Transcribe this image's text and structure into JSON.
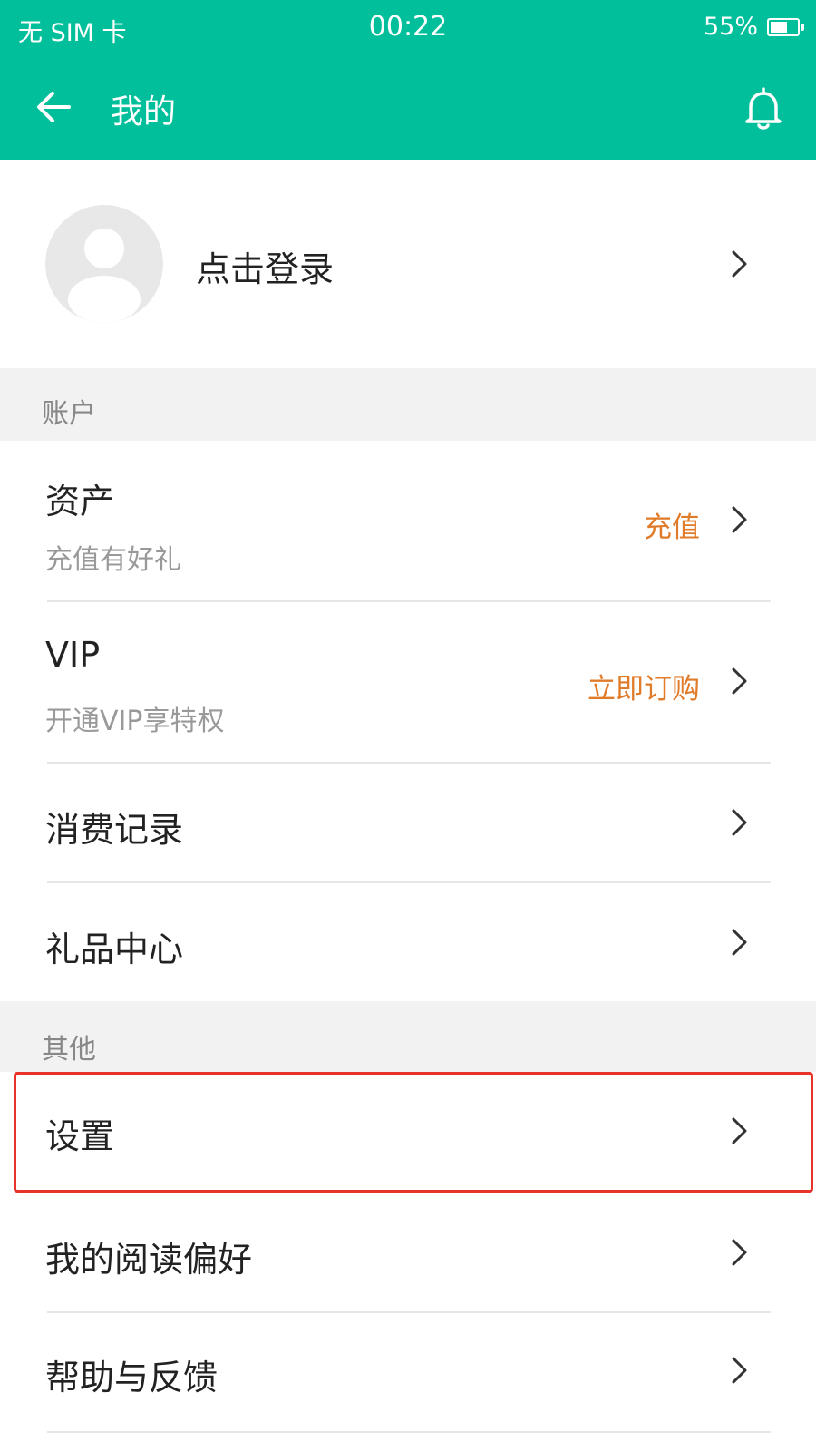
{
  "status_bar": {
    "carrier": "无 SIM 卡",
    "time": "00:22",
    "battery": "55%",
    "battery_level": 0.55
  },
  "appbar": {
    "title": "我的",
    "back_icon": "arrow-left-icon",
    "bell_icon": "bell-icon",
    "color": "#00bf9a"
  },
  "profile": {
    "login_label": "点击登录",
    "avatar_icon": "user-avatar-icon"
  },
  "sections": {
    "account": {
      "header": "账户",
      "items": [
        {
          "title": "资产",
          "subtitle": "充值有好礼",
          "action": "充值"
        },
        {
          "title": "VIP",
          "subtitle": "开通VIP享特权",
          "action": "立即订购"
        },
        {
          "title": "消费记录"
        },
        {
          "title": "礼品中心"
        }
      ]
    },
    "other": {
      "header": "其他",
      "items": [
        {
          "title": "设置"
        },
        {
          "title": "我的阅读偏好"
        },
        {
          "title": "帮助与反馈"
        }
      ]
    }
  },
  "colors": {
    "accent": "#00bf9a",
    "action_text": "#e07b2a",
    "highlight": "#e8332b"
  }
}
